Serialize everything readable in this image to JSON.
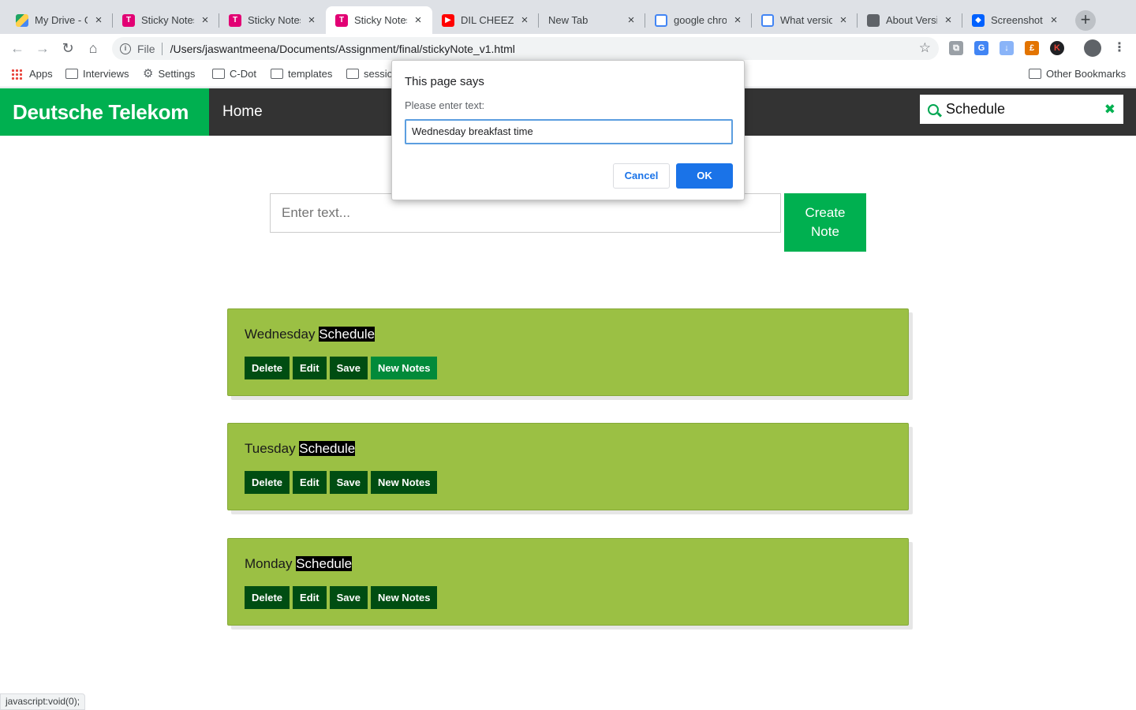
{
  "browser": {
    "tabs": [
      {
        "title": "My Drive - G",
        "favicon": "google-drive-icon",
        "close": "×"
      },
      {
        "title": "Sticky Notes",
        "favicon": "t-mobile-icon",
        "close": "×"
      },
      {
        "title": "Sticky Notes",
        "favicon": "t-mobile-icon",
        "close": "×"
      },
      {
        "title": "Sticky Notes",
        "favicon": "t-mobile-icon",
        "close": "×",
        "active": true
      },
      {
        "title": "DIL CHEEZ T",
        "favicon": "youtube-icon",
        "close": "×"
      },
      {
        "title": "New Tab",
        "favicon": "",
        "close": "×"
      },
      {
        "title": "google chro",
        "favicon": "google-icon",
        "close": "×"
      },
      {
        "title": "What versio",
        "favicon": "google-icon",
        "close": "×"
      },
      {
        "title": "About Versi",
        "favicon": "globe-icon",
        "close": "×"
      },
      {
        "title": "Screenshot",
        "favicon": "dropbox-icon",
        "close": "×"
      }
    ],
    "new_tab": "+",
    "address": {
      "scheme_label": "File",
      "url": "/Users/jaswantmeena/Documents/Assignment/final/stickyNote_v1.html"
    },
    "bookmarks": [
      {
        "label": "Apps",
        "icon": "apps-grid-icon"
      },
      {
        "label": "Interviews",
        "icon": "folder-icon"
      },
      {
        "label": "Settings",
        "icon": "gear-icon"
      },
      {
        "label": "C-Dot",
        "icon": "folder-icon"
      },
      {
        "label": "templates",
        "icon": "folder-icon"
      },
      {
        "label": "sessio",
        "icon": "folder-icon"
      }
    ],
    "other_bookmarks": "Other Bookmarks",
    "status_text": "javascript:void(0);"
  },
  "app": {
    "brand": "Deutsche Telekom",
    "nav_home": "Home",
    "search_value": "Schedule",
    "clear_icon": "✖",
    "input_placeholder": "Enter text...",
    "create_button": "Create Note",
    "notes": [
      {
        "prefix": "Wednesday ",
        "highlight": "Schedule",
        "buttons": {
          "delete": "Delete",
          "edit": "Edit",
          "save": "Save",
          "new_notes": "New Notes"
        }
      },
      {
        "prefix": "Tuesday ",
        "highlight": "Schedule",
        "buttons": {
          "delete": "Delete",
          "edit": "Edit",
          "save": "Save",
          "new_notes": "New Notes"
        }
      },
      {
        "prefix": "Monday ",
        "highlight": "Schedule",
        "buttons": {
          "delete": "Delete",
          "edit": "Edit",
          "save": "Save",
          "new_notes": "New Notes"
        }
      }
    ],
    "colors": {
      "brand_green": "#00b050",
      "header_dark": "#333333",
      "note_bg": "#9bc044",
      "note_button": "#004d12"
    }
  },
  "dialog": {
    "title": "This page says",
    "message": "Please enter text:",
    "input_value": "Wednesday breakfast time",
    "cancel": "Cancel",
    "ok": "OK"
  }
}
